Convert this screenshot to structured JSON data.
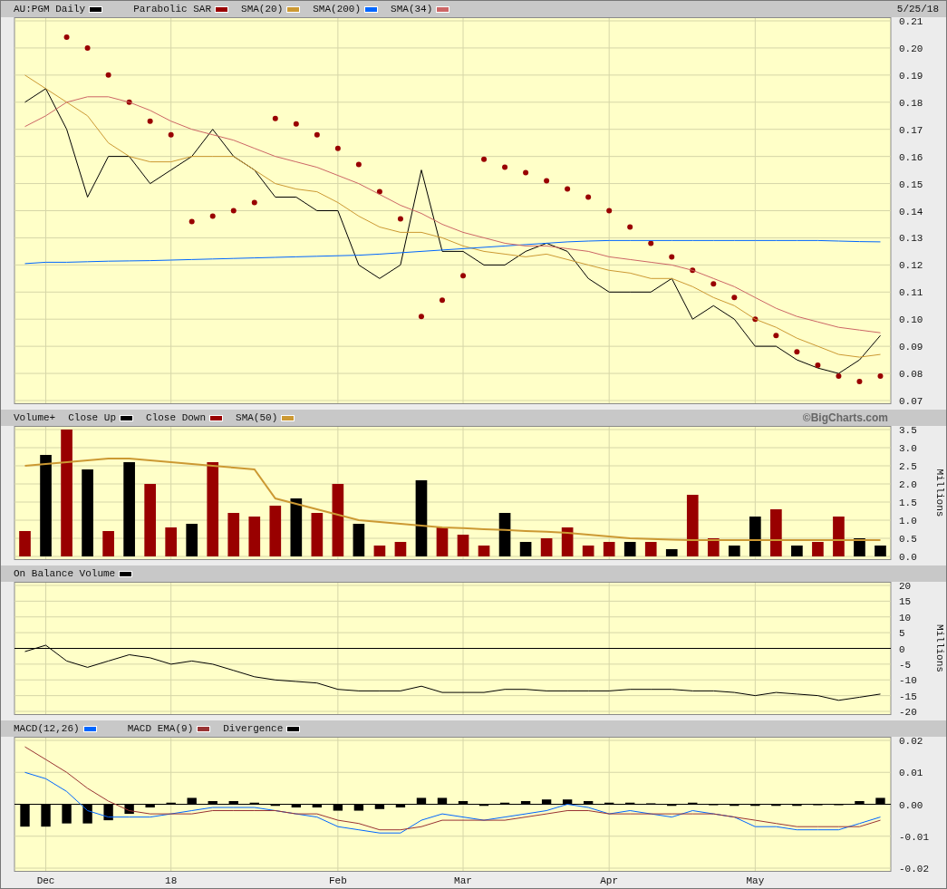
{
  "panels": [
    {
      "date": "5/25/18",
      "chart_data": {
        "type": "line",
        "categories": [
          null,
          null,
          null,
          null,
          null,
          null,
          null,
          null,
          null,
          null,
          null,
          null,
          null,
          null,
          null,
          null,
          null,
          null,
          null,
          null,
          null,
          null,
          null,
          null,
          null,
          null,
          null,
          null,
          null,
          null,
          null,
          null,
          null,
          null,
          null,
          null,
          null,
          null,
          null,
          null,
          null,
          null
        ],
        "grid": true,
        "ylim": [
          0.07,
          0.21
        ],
        "yticks": [
          0.07,
          0.08,
          0.09,
          {
            "value": 0.1,
            "label": "0.10"
          },
          0.11,
          0.12,
          0.13,
          0.14,
          0.15,
          0.16,
          0.17,
          0.18,
          0.19,
          {
            "value": 0.2,
            "label": "0.20"
          },
          0.21
        ],
        "series": [
          {
            "name": "AU:PGM Daily",
            "color": "#000000",
            "type": "line",
            "values": [
              0.18,
              0.185,
              0.17,
              0.145,
              0.16,
              0.16,
              0.15,
              0.155,
              0.16,
              0.17,
              0.16,
              0.155,
              0.145,
              0.145,
              0.14,
              0.14,
              0.12,
              0.115,
              0.12,
              0.155,
              0.125,
              0.125,
              0.12,
              0.12,
              0.125,
              0.128,
              0.125,
              0.115,
              0.11,
              0.11,
              0.11,
              0.115,
              0.1,
              0.105,
              0.1,
              0.09,
              0.09,
              0.085,
              0.082,
              0.08,
              0.085,
              0.094
            ]
          },
          {
            "name": "Parabolic SAR",
            "color": "#990000",
            "type": "scatter",
            "values": [
              null,
              null,
              0.204,
              0.2,
              0.19,
              0.18,
              0.173,
              0.168,
              0.136,
              0.138,
              0.14,
              0.143,
              0.174,
              0.172,
              0.168,
              0.163,
              0.157,
              0.147,
              0.137,
              0.101,
              0.107,
              0.116,
              0.159,
              0.156,
              0.154,
              0.151,
              0.148,
              0.145,
              0.14,
              0.134,
              0.128,
              0.123,
              0.118,
              0.113,
              0.108,
              0.1,
              0.094,
              0.088,
              0.083,
              0.079,
              0.077,
              0.079
            ]
          },
          {
            "name": "SMA(20)",
            "color": "#cc9933",
            "type": "line",
            "values": [
              0.19,
              0.185,
              0.18,
              0.175,
              0.165,
              0.16,
              0.158,
              0.158,
              0.16,
              0.16,
              0.16,
              0.155,
              0.15,
              0.148,
              0.147,
              0.143,
              0.138,
              0.134,
              0.132,
              0.132,
              0.13,
              0.127,
              0.125,
              0.124,
              0.123,
              0.124,
              0.122,
              0.12,
              0.118,
              0.117,
              0.115,
              0.115,
              0.112,
              0.108,
              0.105,
              0.1,
              0.097,
              0.093,
              0.09,
              0.087,
              0.086,
              0.087
            ]
          },
          {
            "name": "SMA(200)",
            "color": "#0066ff",
            "type": "line",
            "values": [
              0.1205,
              0.121,
              0.121,
              0.1212,
              0.1214,
              0.1215,
              0.1216,
              0.1218,
              0.122,
              0.1222,
              0.1224,
              0.1226,
              0.1228,
              0.123,
              0.1232,
              0.1234,
              0.1236,
              0.124,
              0.1245,
              0.125,
              0.1255,
              0.126,
              0.1265,
              0.127,
              0.1275,
              0.128,
              0.1285,
              0.1288,
              0.129,
              0.129,
              0.129,
              0.129,
              0.129,
              0.129,
              0.129,
              0.129,
              0.129,
              0.129,
              0.129,
              0.1288,
              0.1286,
              0.1285
            ]
          },
          {
            "name": "SMA(34)",
            "color": "#cc6666",
            "type": "line",
            "values": [
              0.171,
              0.175,
              0.18,
              0.182,
              0.182,
              0.18,
              0.177,
              0.173,
              0.17,
              0.168,
              0.166,
              0.163,
              0.16,
              0.158,
              0.156,
              0.153,
              0.15,
              0.146,
              0.142,
              0.139,
              0.135,
              0.132,
              0.13,
              0.128,
              0.127,
              0.127,
              0.126,
              0.125,
              0.123,
              0.122,
              0.121,
              0.12,
              0.118,
              0.115,
              0.112,
              0.108,
              0.104,
              0.101,
              0.099,
              0.097,
              0.096,
              0.095
            ]
          }
        ]
      }
    },
    {
      "credit": "©BigCharts.com",
      "chart_data": {
        "type": "bar",
        "title": "Volume+",
        "ylabel": "Millions",
        "categories": [
          null,
          null,
          null,
          null,
          null,
          null,
          null,
          null,
          null,
          null,
          null,
          null,
          null,
          null,
          null,
          null,
          null,
          null,
          null,
          null,
          null,
          null,
          null,
          null,
          null,
          null,
          null,
          null,
          null,
          null,
          null,
          null,
          null,
          null,
          null,
          null,
          null,
          null,
          null,
          null,
          null,
          null
        ],
        "grid": true,
        "ylim": [
          0,
          3.5
        ],
        "yticks": [
          {
            "value": 0,
            "label": "0.0"
          },
          0.5,
          {
            "value": 1,
            "label": "1.0"
          },
          1.5,
          {
            "value": 2,
            "label": "2.0"
          },
          2.5,
          {
            "value": 3,
            "label": "3.0"
          },
          3.5
        ],
        "series": [
          {
            "name": "Close Up",
            "color": "#000000",
            "type": "bar",
            "values": [
              null,
              2.8,
              null,
              2.4,
              null,
              2.6,
              null,
              null,
              0.9,
              null,
              null,
              null,
              null,
              1.6,
              null,
              null,
              0.9,
              null,
              null,
              2.1,
              null,
              null,
              null,
              1.2,
              0.4,
              null,
              null,
              null,
              null,
              0.4,
              null,
              0.2,
              null,
              null,
              0.3,
              1.1,
              null,
              0.3,
              null,
              null,
              0.5,
              0.3
            ]
          },
          {
            "name": "Close Down",
            "color": "#990000",
            "type": "bar",
            "values": [
              0.7,
              null,
              3.5,
              null,
              0.7,
              null,
              2.0,
              0.8,
              null,
              2.6,
              1.2,
              1.1,
              1.4,
              null,
              1.2,
              2.0,
              null,
              0.3,
              0.4,
              null,
              0.8,
              0.6,
              0.3,
              null,
              null,
              0.5,
              0.8,
              0.3,
              0.4,
              null,
              0.4,
              null,
              1.7,
              0.5,
              null,
              null,
              1.3,
              null,
              0.4,
              1.1,
              null,
              null
            ]
          },
          {
            "name": "SMA(50)",
            "color": "#cc9933",
            "type": "line",
            "values": [
              2.5,
              2.55,
              2.6,
              2.65,
              2.7,
              2.7,
              2.65,
              2.6,
              2.55,
              2.5,
              2.45,
              2.4,
              1.6,
              1.45,
              1.3,
              1.15,
              1.0,
              0.95,
              0.9,
              0.85,
              0.8,
              0.78,
              0.75,
              0.73,
              0.7,
              0.68,
              0.65,
              0.6,
              0.55,
              0.5,
              0.48,
              0.46,
              0.45,
              0.45,
              0.45,
              0.45,
              0.45,
              0.45,
              0.45,
              0.45,
              0.45,
              0.45
            ]
          }
        ]
      }
    },
    {
      "chart_data": {
        "type": "line",
        "ylabel": "Millions",
        "categories": [
          null,
          null,
          null,
          null,
          null,
          null,
          null,
          null,
          null,
          null,
          null,
          null,
          null,
          null,
          null,
          null,
          null,
          null,
          null,
          null,
          null,
          null,
          null,
          null,
          null,
          null,
          null,
          null,
          null,
          null,
          null,
          null,
          null,
          null,
          null,
          null,
          null,
          null,
          null,
          null,
          null,
          null
        ],
        "grid": true,
        "ylim": [
          -20,
          20
        ],
        "yticks": [
          20,
          15,
          10,
          5,
          0,
          -5,
          -10,
          -15,
          -20
        ],
        "series": [
          {
            "name": "On Balance Volume",
            "color": "#000000",
            "type": "line",
            "values": [
              -1,
              1,
              -4,
              -6,
              -4,
              -2,
              -3,
              -5,
              -4,
              -5,
              -7,
              -9,
              -10,
              -10.5,
              -11,
              -13,
              -13.5,
              -13.5,
              -13.5,
              -12,
              -14,
              -14,
              -14,
              -13,
              -13,
              -13.5,
              -13.5,
              -13.5,
              -13.5,
              -13,
              -13,
              -13,
              -13.5,
              -13.5,
              -14,
              -15,
              -14,
              -14.5,
              -15,
              -16.5,
              -15.5,
              -14.5
            ]
          }
        ]
      }
    },
    {
      "chart_data": {
        "type": "line",
        "categories": [
          null,
          "Dec",
          null,
          null,
          null,
          null,
          null,
          "18",
          null,
          null,
          null,
          null,
          null,
          null,
          null,
          "Feb",
          null,
          null,
          null,
          null,
          null,
          "Mar",
          null,
          null,
          null,
          null,
          null,
          null,
          "Apr",
          null,
          null,
          null,
          null,
          null,
          null,
          "May",
          null,
          null,
          null,
          null,
          null,
          null
        ],
        "grid": true,
        "ylim": [
          -0.02,
          0.02
        ],
        "yticks": [
          0.02,
          0.01,
          {
            "value": 0,
            "label": "0.00"
          },
          -0.01,
          -0.02
        ],
        "series": [
          {
            "name": "MACD(12,26)",
            "color": "#0066ff",
            "type": "line",
            "values": [
              0.01,
              0.008,
              0.004,
              -0.002,
              -0.004,
              -0.004,
              -0.004,
              -0.003,
              -0.002,
              -0.001,
              -0.001,
              -0.001,
              -0.002,
              -0.003,
              -0.004,
              -0.007,
              -0.008,
              -0.009,
              -0.009,
              -0.005,
              -0.003,
              -0.004,
              -0.005,
              -0.004,
              -0.003,
              -0.002,
              0,
              -0.001,
              -0.003,
              -0.002,
              -0.003,
              -0.004,
              -0.002,
              -0.003,
              -0.004,
              -0.007,
              -0.007,
              -0.008,
              -0.008,
              -0.008,
              -0.006,
              -0.004
            ]
          },
          {
            "name": "MACD EMA(9)",
            "color": "#993333",
            "type": "line",
            "values": [
              0.018,
              0.014,
              0.01,
              0.005,
              0.001,
              -0.002,
              -0.003,
              -0.003,
              -0.003,
              -0.002,
              -0.002,
              -0.002,
              -0.002,
              -0.003,
              -0.003,
              -0.005,
              -0.006,
              -0.008,
              -0.008,
              -0.007,
              -0.005,
              -0.005,
              -0.005,
              -0.005,
              -0.004,
              -0.003,
              -0.002,
              -0.002,
              -0.003,
              -0.003,
              -0.003,
              -0.003,
              -0.003,
              -0.003,
              -0.004,
              -0.005,
              -0.006,
              -0.007,
              -0.007,
              -0.007,
              -0.007,
              -0.005
            ]
          },
          {
            "name": "Divergence",
            "color": "#000000",
            "type": "bar",
            "values": [
              -0.007,
              -0.007,
              -0.006,
              -0.006,
              -0.005,
              -0.003,
              -0.001,
              0.0005,
              0.002,
              0.001,
              0.001,
              0.0005,
              -0.0005,
              -0.001,
              -0.001,
              -0.002,
              -0.002,
              -0.0015,
              -0.001,
              0.002,
              0.002,
              0.001,
              -0.0005,
              0.0005,
              0.001,
              0.0015,
              0.0015,
              0.001,
              0.0005,
              0.0005,
              0.0003,
              -0.0005,
              0.0005,
              -0.0003,
              -0.0005,
              -0.0005,
              -0.0005,
              -0.0005,
              -0.0003,
              -0.0002,
              0.001,
              0.002
            ]
          }
        ]
      }
    }
  ]
}
